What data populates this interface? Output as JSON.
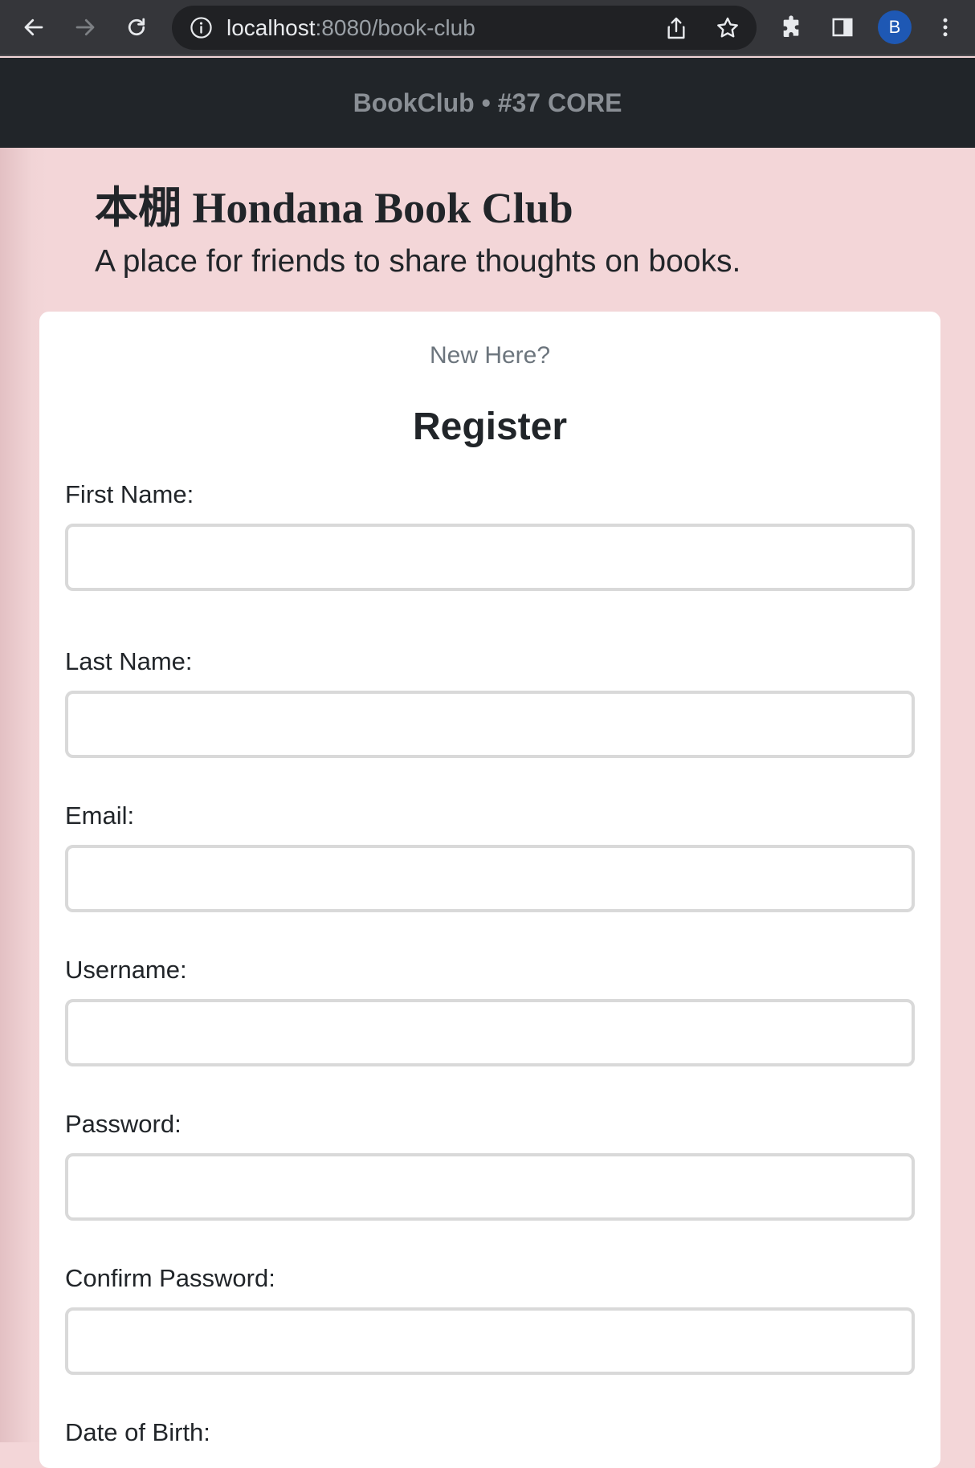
{
  "browser": {
    "url_host": "localhost",
    "url_rest": ":8080/book-club",
    "profile_initial": "B"
  },
  "navbar": {
    "brand": "BookClub • #37 CORE"
  },
  "hero": {
    "title": "本棚 Hondana Book Club",
    "subtitle": "A place for friends to share thoughts on books."
  },
  "register": {
    "eyebrow": "New Here?",
    "title": "Register",
    "fields": [
      {
        "label": "First Name:",
        "value": ""
      },
      {
        "label": "Last Name:",
        "value": ""
      },
      {
        "label": "Email:",
        "value": ""
      },
      {
        "label": "Username:",
        "value": ""
      },
      {
        "label": "Password:",
        "value": ""
      },
      {
        "label": "Confirm Password:",
        "value": ""
      },
      {
        "label": "Date of Birth:",
        "value": ""
      }
    ]
  },
  "colors": {
    "page_bg": "#f3d6d8",
    "navbar_bg": "#212529",
    "avatar_bg": "#1e58b4"
  }
}
